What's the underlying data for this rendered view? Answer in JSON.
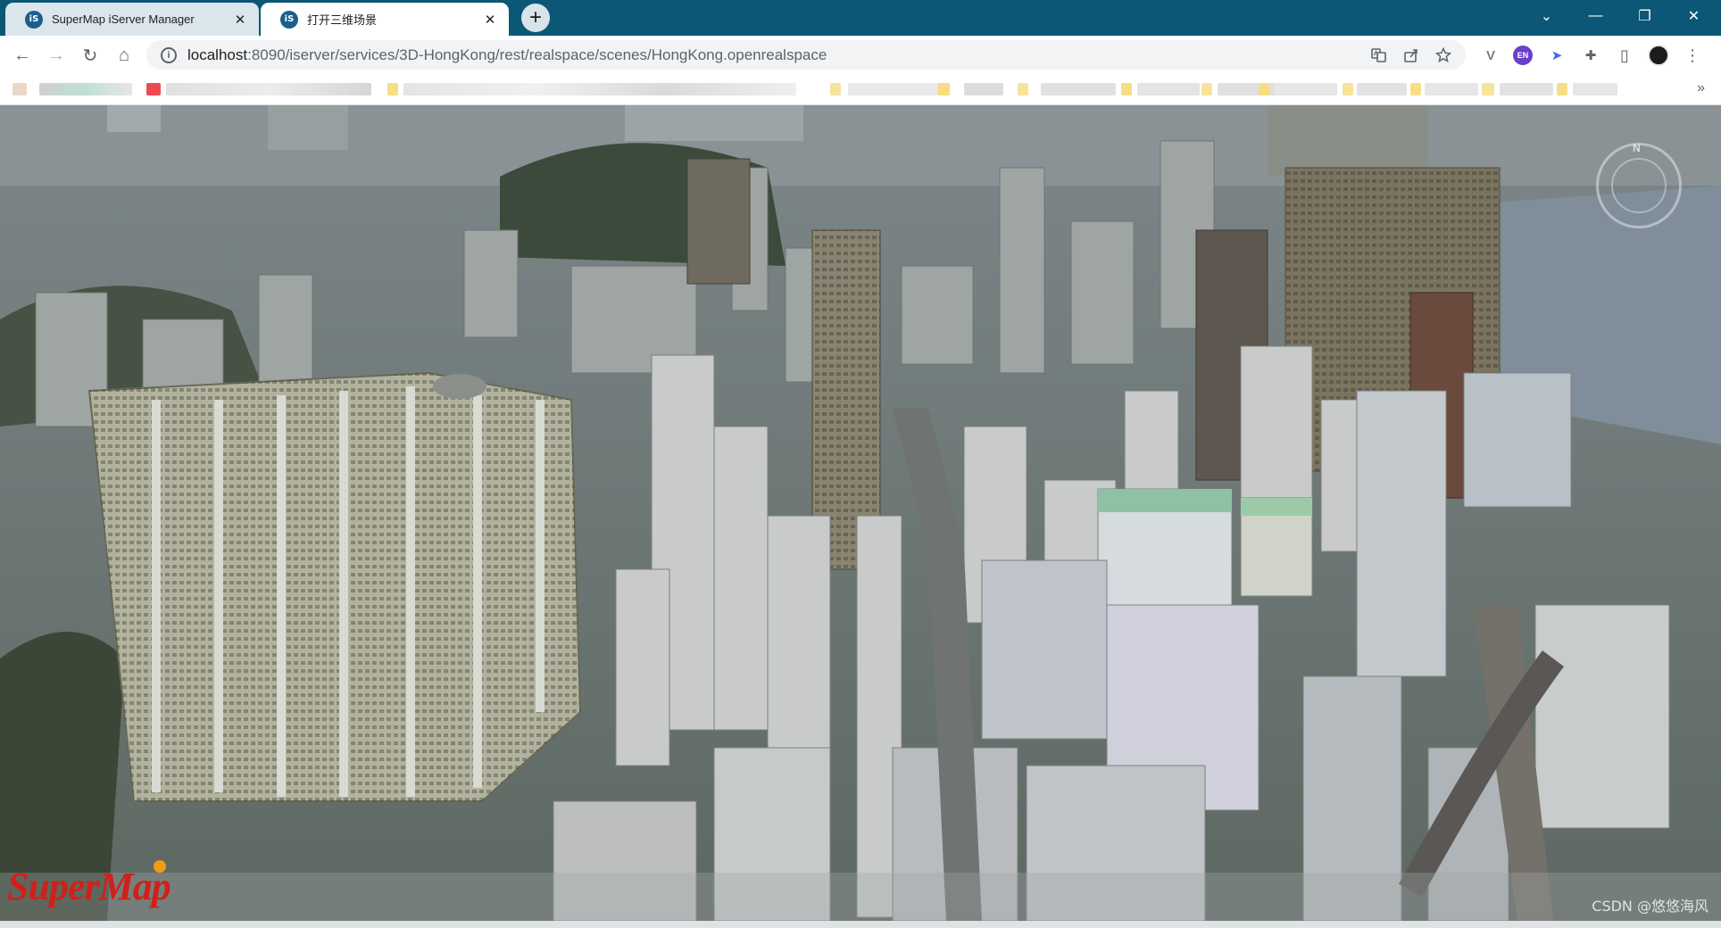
{
  "browser": {
    "tabs": [
      {
        "favicon": "iS",
        "title": "SuperMap iServer Manager",
        "close": "✕"
      },
      {
        "favicon": "iS",
        "title": "打开三维场景",
        "close": "✕"
      }
    ],
    "new_tab": "+",
    "window_controls": {
      "tab_search": "⌄",
      "minimize": "—",
      "restore": "❐",
      "close": "✕"
    },
    "nav": {
      "back": "←",
      "forward": "→",
      "reload": "↻",
      "home": "⌂"
    },
    "address": {
      "info_glyph": "i",
      "host": "localhost",
      "rest": ":8090/iserver/services/3D-HongKong/rest/realspace/scenes/HongKong.openrealspace"
    },
    "omnibox_icons": [
      "translate-icon",
      "share-icon",
      "star-icon"
    ],
    "extensions": [
      {
        "name": "vue-devtools-icon",
        "glyph": "V"
      },
      {
        "name": "en-badge-icon",
        "glyph": "EN"
      },
      {
        "name": "bird-extension-icon",
        "glyph": "➤"
      },
      {
        "name": "puzzle-icon",
        "glyph": "✚"
      },
      {
        "name": "side-panel-icon",
        "glyph": "▯"
      },
      {
        "name": "profile-avatar",
        "glyph": "●"
      },
      {
        "name": "menu-kebab-icon",
        "glyph": "⋮"
      }
    ],
    "bookmarks_more": "»"
  },
  "scene": {
    "compass_label": "N",
    "logo": "SuperMap",
    "watermark": "CSDN @悠悠海风"
  }
}
